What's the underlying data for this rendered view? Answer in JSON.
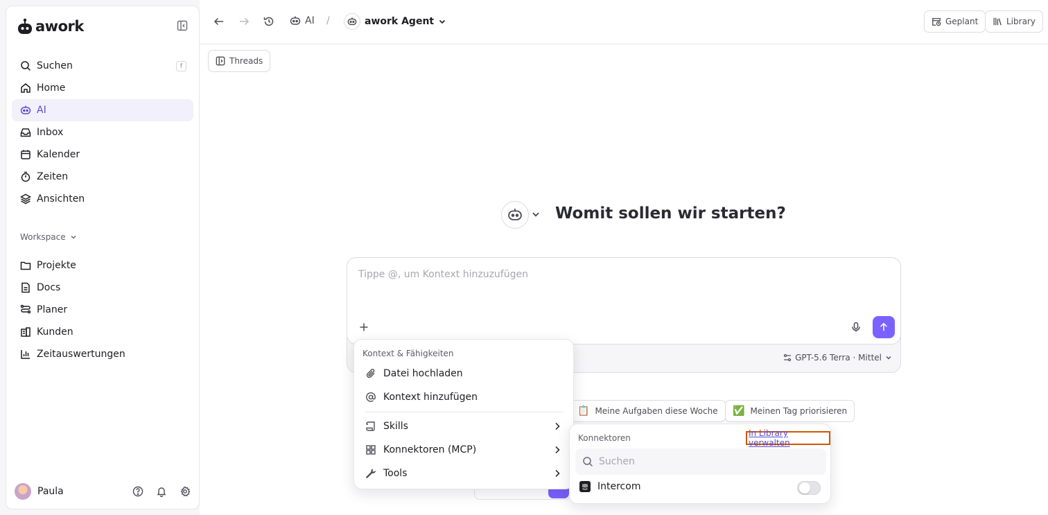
{
  "app": {
    "logo_text": "awork"
  },
  "sidebar": {
    "search": {
      "label": "Suchen",
      "shortcut": "f"
    },
    "items": [
      {
        "label": "Home",
        "icon": "home-icon"
      },
      {
        "label": "AI",
        "icon": "ai-bot-icon",
        "active": true
      },
      {
        "label": "Inbox",
        "icon": "inbox-icon"
      },
      {
        "label": "Kalender",
        "icon": "calendar-icon"
      },
      {
        "label": "Zeiten",
        "icon": "timer-icon"
      },
      {
        "label": "Ansichten",
        "icon": "layers-icon"
      }
    ],
    "workspace_label": "Workspace",
    "workspace_items": [
      {
        "label": "Projekte",
        "icon": "folder-icon"
      },
      {
        "label": "Docs",
        "icon": "document-icon"
      },
      {
        "label": "Planer",
        "icon": "planner-icon"
      },
      {
        "label": "Kunden",
        "icon": "building-icon"
      },
      {
        "label": "Zeitauswertungen",
        "icon": "bar-chart-icon"
      }
    ],
    "user": {
      "name": "Paula"
    }
  },
  "topbar": {
    "breadcrumb_ai": "AI",
    "breadcrumb_sep": "/",
    "agent_label": "awork Agent",
    "scheduled_label": "Geplant",
    "library_label": "Library"
  },
  "main": {
    "threads_label": "Threads",
    "hero_title": "Womit sollen wir starten?",
    "composer_placeholder": "Tippe @, um Kontext hinzuzufügen",
    "model_label": "GPT-5.6 Terra · Mittel",
    "suggestions": [
      {
        "emoji": "📋",
        "label": "Meine Aufgaben diese Woche"
      },
      {
        "emoji": "✅",
        "label": "Meinen Tag priorisieren"
      }
    ]
  },
  "context_menu": {
    "header": "Kontext & Fähigkeiten",
    "items": [
      {
        "label": "Datei hochladen",
        "icon": "paperclip-icon"
      },
      {
        "label": "Kontext hinzufügen",
        "icon": "at-sign-icon"
      },
      {
        "label": "Skills",
        "icon": "scroll-icon"
      },
      {
        "label": "Konnektoren (MCP)",
        "icon": "blocks-icon"
      },
      {
        "label": "Tools",
        "icon": "wrench-icon"
      }
    ]
  },
  "connectors_menu": {
    "header": "Konnektoren",
    "manage_link": "In Library verwalten",
    "search_placeholder": "Suchen",
    "items": [
      {
        "label": "Intercom",
        "enabled": false
      }
    ]
  },
  "colors": {
    "accent": "#7b61ff",
    "active_bg": "#f1f0fb",
    "highlight_border": "#d35400"
  }
}
